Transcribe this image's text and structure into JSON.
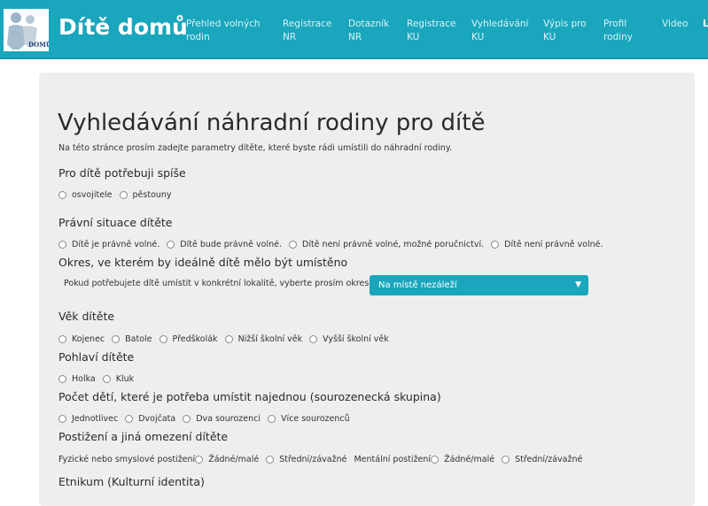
{
  "navbar": {
    "brand": "Dítě domů",
    "logo_text": "DOMŮ",
    "items": [
      {
        "line1": "Přehled volných",
        "line2": "rodin"
      },
      {
        "line1": "Registrace",
        "line2": "NR"
      },
      {
        "line1": "Dotazník",
        "line2": "NR"
      },
      {
        "line1": "Registrace",
        "line2": "KU"
      },
      {
        "line1": "Vyhledávání",
        "line2": "KU"
      },
      {
        "line1": "Výpis pro",
        "line2": "KU"
      },
      {
        "line1": "Profil",
        "line2": "rodiny"
      },
      {
        "line1": "Video",
        "line2": ""
      }
    ],
    "cut_item": "L"
  },
  "page": {
    "title": "Vyhledávání náhradní rodiny pro dítě",
    "intro": "Na této stránce prosím zadejte parametry dítěte, které byste rádi umístili do náhradní rodiny."
  },
  "sections": {
    "need": {
      "title": "Pro dítě potřebuji spíše",
      "options": [
        "osvojitele",
        "pěstouny"
      ]
    },
    "legal": {
      "title": "Právní situace dítěte",
      "options": [
        "Dítě je právně volné.",
        "Dítě bude právně volné.",
        "Dítě není právně volné, možné poručnictví.",
        "Dítě není právně volné."
      ]
    },
    "region": {
      "title": "Okres, ve kterém by ideálně dítě mělo být umístěno",
      "label": "Pokud potřebujete dítě umístit v konkrétní lokalitě, vyberte prosím okres:",
      "selected": "Na místě nezáleží"
    },
    "age": {
      "title": "Věk dítěte",
      "options": [
        "Kojenec",
        "Batole",
        "Předškolák",
        "Nižší školní věk",
        "Vyšší školní věk"
      ]
    },
    "gender": {
      "title": "Pohlaví dítěte",
      "options": [
        "Holka",
        "Kluk"
      ]
    },
    "siblings": {
      "title": "Počet dětí, které je potřeba umístit najednou (sourozenecká skupina)",
      "options": [
        "Jednotlivec",
        "Dvojčata",
        "Dva sourozenci",
        "Více sourozenců"
      ]
    },
    "disability": {
      "title": "Postižení a jiná omezení dítěte",
      "physical_label": "Fyzické nebo smyslové postižení",
      "physical_options": [
        "Žádné/malé",
        "Střední/závažné"
      ],
      "mental_label": "Mentální postižení",
      "mental_options": [
        "Žádné/malé",
        "Střední/závažné"
      ]
    },
    "ethnicity": {
      "title": "Etnikum (Kulturní identita)"
    }
  },
  "colors": {
    "accent": "#1aa6bd",
    "panel": "#eceeef"
  }
}
